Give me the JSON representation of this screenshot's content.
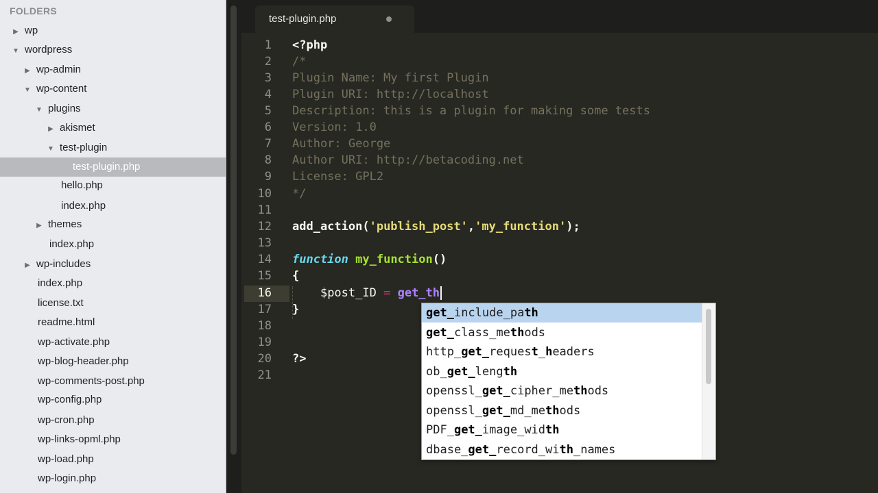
{
  "sidebar": {
    "header": "FOLDERS",
    "items": [
      {
        "label": "wp",
        "arrow": "▶"
      },
      {
        "label": "wordpress",
        "arrow": "▼"
      },
      {
        "label": "wp-admin",
        "arrow": "▶"
      },
      {
        "label": "wp-content",
        "arrow": "▼"
      },
      {
        "label": "plugins",
        "arrow": "▼"
      },
      {
        "label": "akismet",
        "arrow": "▶"
      },
      {
        "label": "test-plugin",
        "arrow": "▼"
      },
      {
        "label": "test-plugin.php",
        "arrow": ""
      },
      {
        "label": "hello.php",
        "arrow": ""
      },
      {
        "label": "index.php",
        "arrow": ""
      },
      {
        "label": "themes",
        "arrow": "▶"
      },
      {
        "label": "index.php",
        "arrow": ""
      },
      {
        "label": "wp-includes",
        "arrow": "▶"
      },
      {
        "label": "index.php",
        "arrow": ""
      },
      {
        "label": "license.txt",
        "arrow": ""
      },
      {
        "label": "readme.html",
        "arrow": ""
      },
      {
        "label": "wp-activate.php",
        "arrow": ""
      },
      {
        "label": "wp-blog-header.php",
        "arrow": ""
      },
      {
        "label": "wp-comments-post.php",
        "arrow": ""
      },
      {
        "label": "wp-config.php",
        "arrow": ""
      },
      {
        "label": "wp-cron.php",
        "arrow": ""
      },
      {
        "label": "wp-links-opml.php",
        "arrow": ""
      },
      {
        "label": "wp-load.php",
        "arrow": ""
      },
      {
        "label": "wp-login.php",
        "arrow": ""
      }
    ]
  },
  "tab": {
    "label": "test-plugin.php"
  },
  "editor": {
    "line_numbers": [
      "1",
      "2",
      "3",
      "4",
      "5",
      "6",
      "7",
      "8",
      "9",
      "10",
      "11",
      "12",
      "13",
      "14",
      "15",
      "16",
      "17",
      "18",
      "19",
      "20",
      "21"
    ],
    "code": {
      "l1": "<?php",
      "l2": "/*",
      "l3": "Plugin Name: My first Plugin",
      "l4": "Plugin URI: http://localhost",
      "l5": "Description: this is a plugin for making some tests",
      "l6": "Version: 1.0",
      "l7": "Author: George",
      "l8": "Author URI: http://betacoding.net",
      "l9": "License: GPL2",
      "l10": "*/",
      "l12": {
        "fn": "add_action(",
        "s1": "'publish_post'",
        "comma": ",",
        "s2": "'my_function'",
        "end": ");"
      },
      "l14": {
        "kw": "function",
        "name": "my_function",
        "parens": "()"
      },
      "l15": "{",
      "l16": {
        "var": "$post_ID",
        "op": "=",
        "partial": "get_th"
      },
      "l17": "}",
      "l20": "?>"
    }
  },
  "autocomplete": {
    "items": [
      [
        {
          "t": "get_",
          "b": true
        },
        {
          "t": "include_pa",
          "b": false
        },
        {
          "t": "th",
          "b": true
        }
      ],
      [
        {
          "t": "get_",
          "b": true
        },
        {
          "t": "class_me",
          "b": false
        },
        {
          "t": "th",
          "b": true
        },
        {
          "t": "ods",
          "b": false
        }
      ],
      [
        {
          "t": "http_",
          "b": false
        },
        {
          "t": "get_",
          "b": true
        },
        {
          "t": "reques",
          "b": false
        },
        {
          "t": "t",
          "b": true
        },
        {
          "t": "_",
          "b": false
        },
        {
          "t": "h",
          "b": true
        },
        {
          "t": "eaders",
          "b": false
        }
      ],
      [
        {
          "t": "ob_",
          "b": false
        },
        {
          "t": "get_",
          "b": true
        },
        {
          "t": "leng",
          "b": false
        },
        {
          "t": "th",
          "b": true
        }
      ],
      [
        {
          "t": "openssl_",
          "b": false
        },
        {
          "t": "get_",
          "b": true
        },
        {
          "t": "cipher_me",
          "b": false
        },
        {
          "t": "th",
          "b": true
        },
        {
          "t": "ods",
          "b": false
        }
      ],
      [
        {
          "t": "openssl_",
          "b": false
        },
        {
          "t": "get_",
          "b": true
        },
        {
          "t": "md_me",
          "b": false
        },
        {
          "t": "th",
          "b": true
        },
        {
          "t": "ods",
          "b": false
        }
      ],
      [
        {
          "t": "PDF_",
          "b": false
        },
        {
          "t": "get_",
          "b": true
        },
        {
          "t": "image_wid",
          "b": false
        },
        {
          "t": "th",
          "b": true
        }
      ],
      [
        {
          "t": "dbase_",
          "b": false
        },
        {
          "t": "get_",
          "b": true
        },
        {
          "t": "record_wi",
          "b": false
        },
        {
          "t": "th",
          "b": true
        },
        {
          "t": "_names",
          "b": false
        }
      ]
    ]
  }
}
